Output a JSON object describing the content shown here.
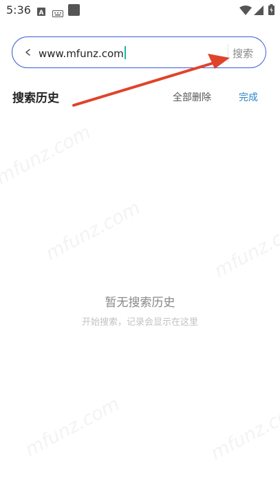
{
  "status_bar": {
    "time": "5:36"
  },
  "search": {
    "query": "www.mfunz.com",
    "button_label": "搜索"
  },
  "history": {
    "title": "搜索历史",
    "delete_all_label": "全部删除",
    "done_label": "完成"
  },
  "empty_state": {
    "title": "暂无搜索历史",
    "subtitle": "开始搜索，记录会显示在这里"
  },
  "watermark": {
    "text": "mfunz.com"
  },
  "colors": {
    "accent_border": "#3b5bdb",
    "caret": "#14b8a6",
    "done": "#2a86c8",
    "annotation_arrow": "#e0432a"
  }
}
